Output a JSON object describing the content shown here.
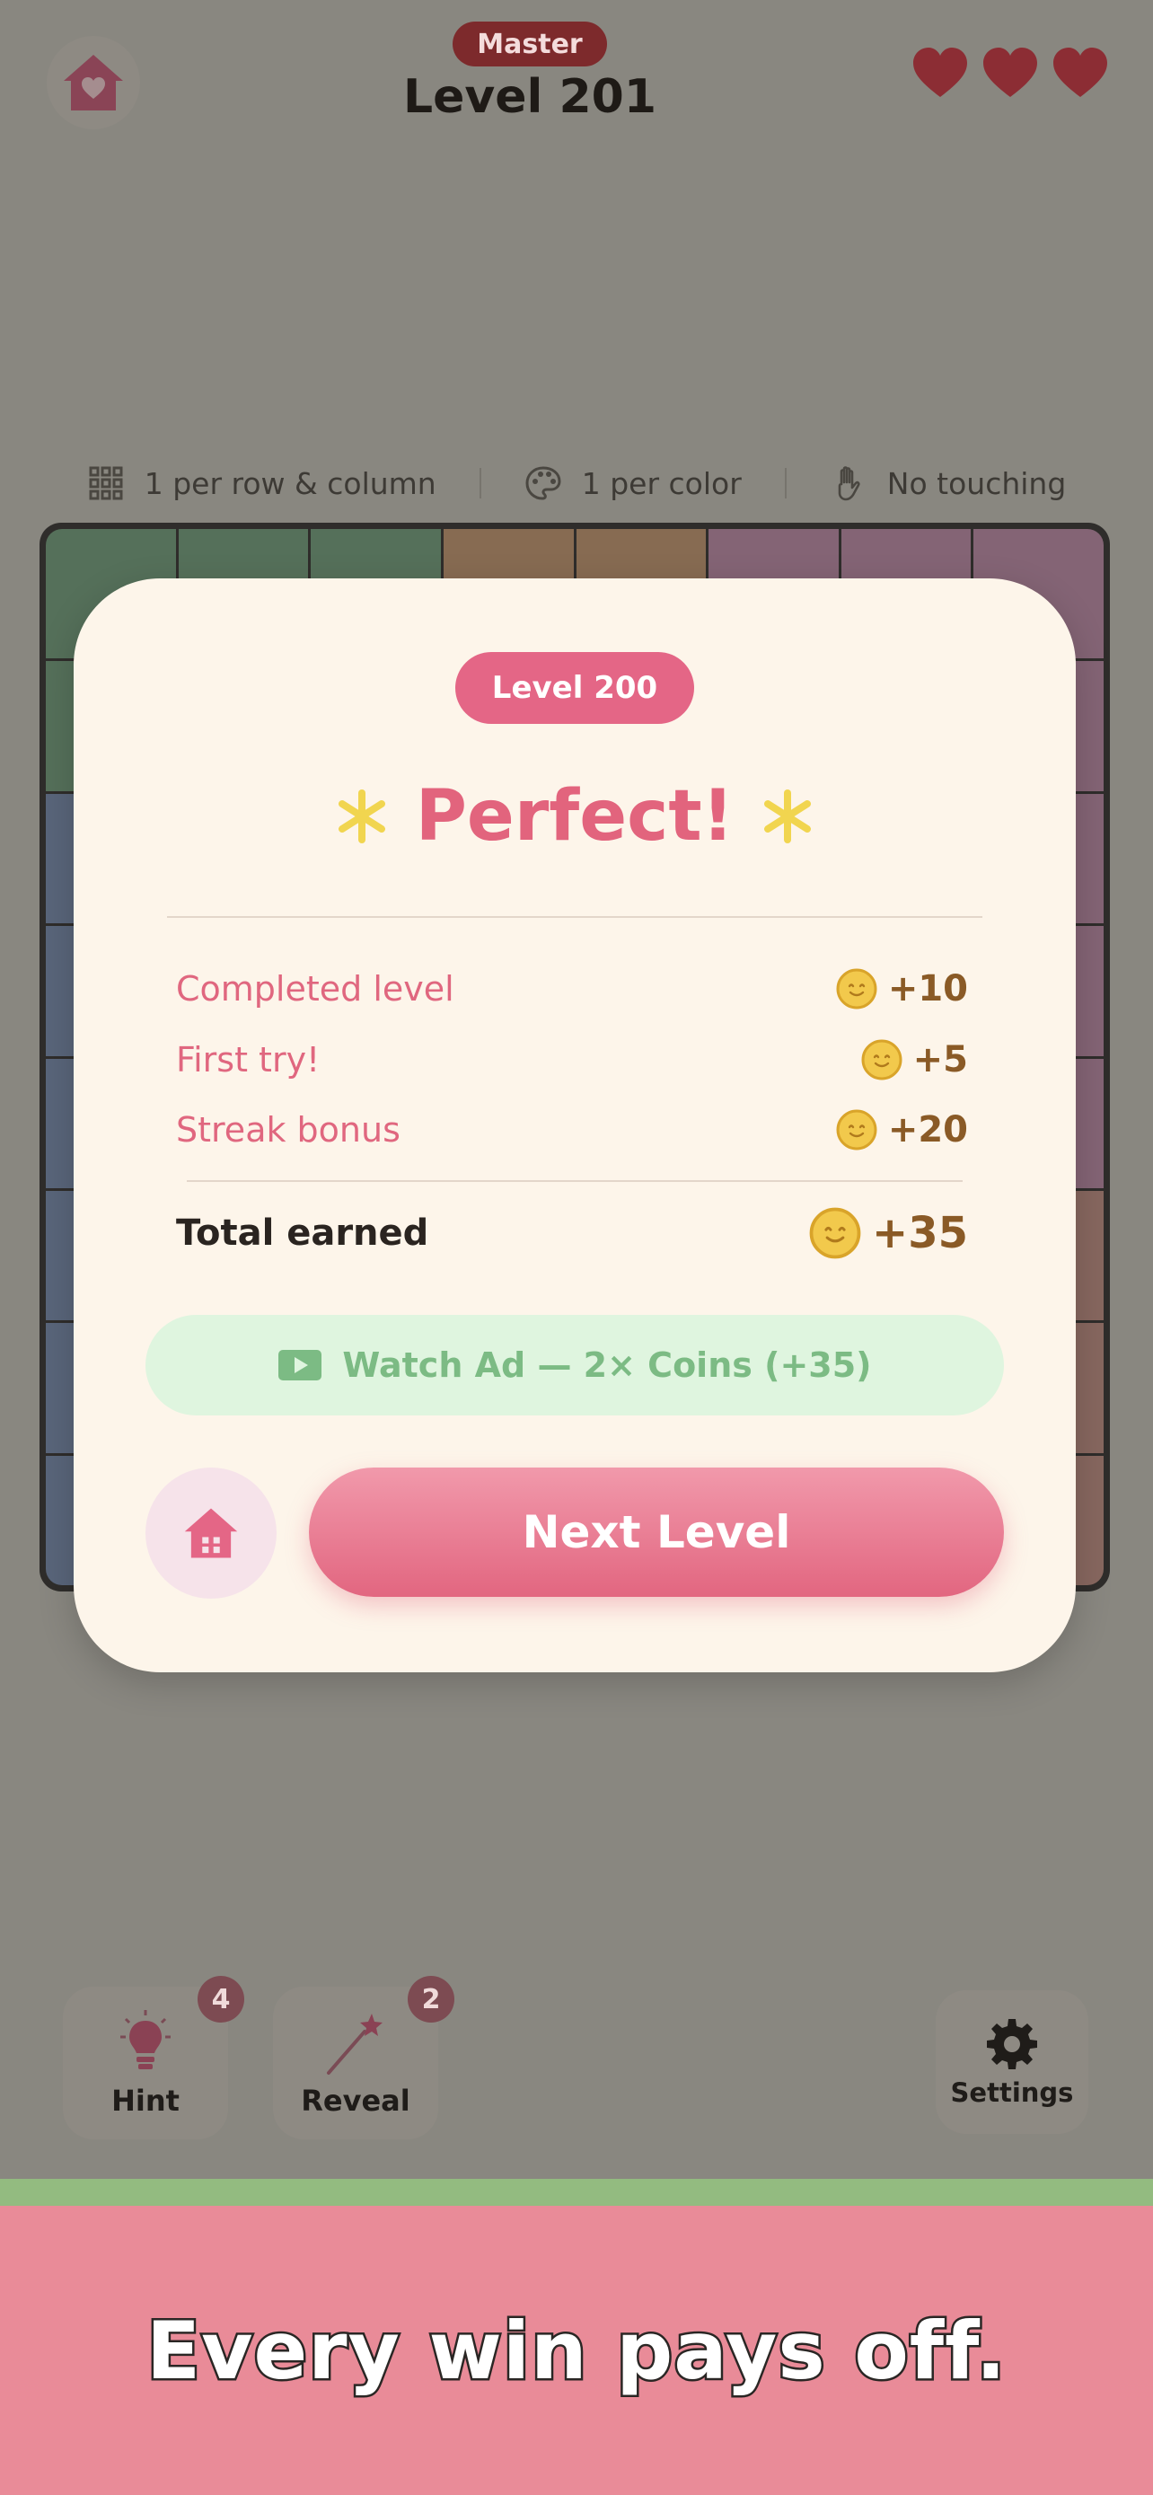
{
  "header": {
    "difficulty": "Master",
    "level_title": "Level 201",
    "lives": 3
  },
  "rules": [
    {
      "icon": "grid-icon",
      "label": "1 per row & column"
    },
    {
      "icon": "palette-icon",
      "label": "1 per color"
    },
    {
      "icon": "hand-icon",
      "label": "No touching"
    }
  ],
  "modal": {
    "level_pill": "Level 200",
    "title": "Perfect!",
    "rewards": [
      {
        "label": "Completed level",
        "amount": "+10"
      },
      {
        "label": "First try!",
        "amount": "+5"
      },
      {
        "label": "Streak bonus",
        "amount": "+20"
      }
    ],
    "total": {
      "label": "Total earned",
      "amount": "+35"
    },
    "ad_button": "Watch Ad — 2× Coins (+35)",
    "next_button": "Next Level"
  },
  "tools": {
    "hint": {
      "label": "Hint",
      "count": "4"
    },
    "reveal": {
      "label": "Reveal",
      "count": "2"
    },
    "settings": {
      "label": "Settings"
    }
  },
  "banner": {
    "text": "Every win pays off."
  },
  "colors": {
    "accent_pink": "#e2647d",
    "coin_text": "#8a5a26",
    "ad_green": "#7cbb84",
    "banner_pink": "#e98b98",
    "overlay": "#898780"
  }
}
